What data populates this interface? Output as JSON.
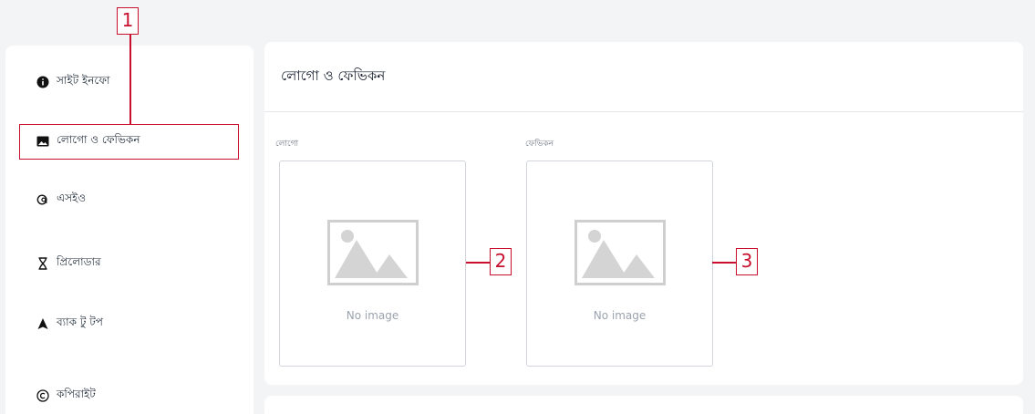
{
  "sidebar": {
    "items": [
      {
        "label": "সাইট ইনফো",
        "icon": "info-icon"
      },
      {
        "label": "লোগো ও ফেভিকন",
        "icon": "image-icon"
      },
      {
        "label": "এসইও",
        "icon": "seo-icon"
      },
      {
        "label": "প্রিলোডার",
        "icon": "hourglass-icon"
      },
      {
        "label": "ব্যাক টু টপ",
        "icon": "arrow-up-icon"
      },
      {
        "label": "কপিরাইট",
        "icon": "copyright-icon"
      }
    ]
  },
  "main": {
    "title": "লোগো ও ফেভিকন",
    "fields": [
      {
        "label": "লোগো",
        "placeholder": "No image"
      },
      {
        "label": "ফেভিকন",
        "placeholder": "No image"
      }
    ]
  },
  "annotations": {
    "markers": [
      "1",
      "2",
      "3"
    ],
    "color": "#c8102e"
  }
}
